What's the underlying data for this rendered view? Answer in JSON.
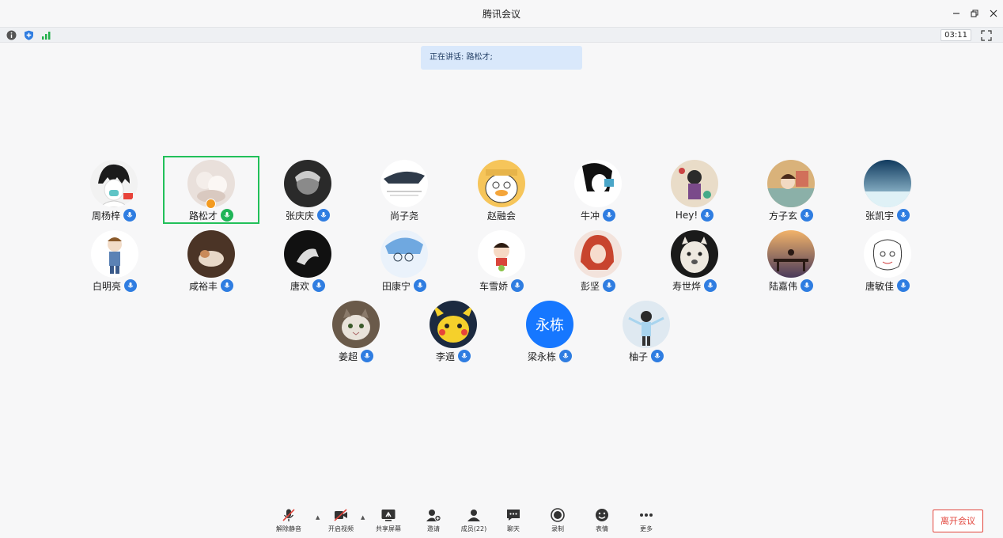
{
  "window": {
    "title": "腾讯会议"
  },
  "statusbar": {
    "timer": "03:11"
  },
  "speaking": {
    "text": "正在讲话: 路松才;"
  },
  "participants": [
    {
      "name": "周杨梓"
    },
    {
      "name": "路松才"
    },
    {
      "name": "张庆庆"
    },
    {
      "name": "尚子尧"
    },
    {
      "name": "赵融会"
    },
    {
      "name": "牛冲"
    },
    {
      "name": "Hey!"
    },
    {
      "name": "方子玄"
    },
    {
      "name": "张凯宇"
    },
    {
      "name": "白明亮"
    },
    {
      "name": "咸裕丰"
    },
    {
      "name": "唐欢"
    },
    {
      "name": "田康宁"
    },
    {
      "name": "车雪娇"
    },
    {
      "name": "彭坚"
    },
    {
      "name": "寿世烨"
    },
    {
      "name": "陆嘉伟"
    },
    {
      "name": "唐敏佳"
    },
    {
      "name": "姜超"
    },
    {
      "name": "李遁"
    },
    {
      "name": "梁永栋",
      "avatar_text": "永栋"
    },
    {
      "name": "柚子"
    }
  ],
  "toolbar": {
    "unmute": "解除静音",
    "start_video": "开启视频",
    "share_screen": "共享屏幕",
    "invite": "邀请",
    "members": "成员(22)",
    "chat": "聊天",
    "record": "录制",
    "reactions": "表情",
    "more": "更多",
    "leave": "离开会议"
  },
  "colors": {
    "accent": "#2f7de1",
    "active_border": "#22c05a",
    "leave": "#e2453c"
  }
}
